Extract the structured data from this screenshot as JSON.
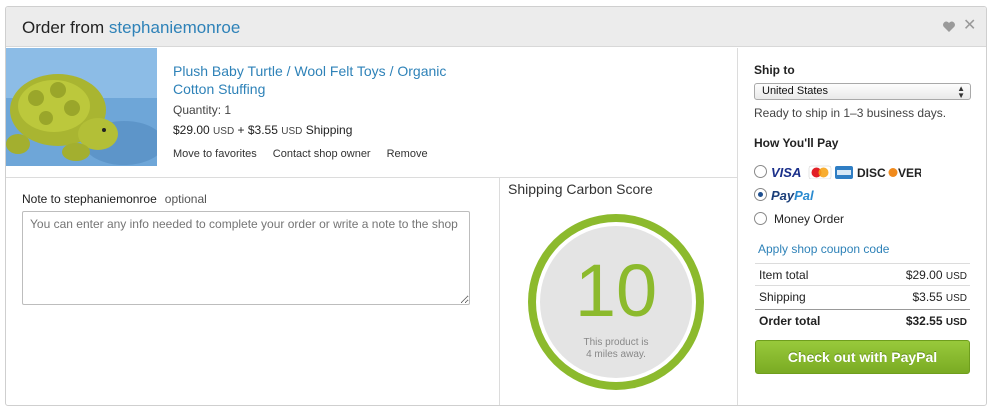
{
  "header": {
    "title_prefix": "Order from ",
    "shop_name": "stephaniemonroe"
  },
  "item": {
    "title": "Plush Baby Turtle / Wool Felt Toys / Organic Cotton Stuffing",
    "quantity": "Quantity: 1",
    "price": "$29.00",
    "price_currency": "USD",
    "plus": " + ",
    "shipping": "$3.55",
    "shipping_currency": "USD",
    "shipping_label": " Shipping",
    "links": [
      "Move to favorites",
      "Contact shop owner",
      "Remove"
    ]
  },
  "note": {
    "label": "Note to stephaniemonroe",
    "optional": "optional",
    "placeholder": "You can enter any info needed to complete your order or write a note to the shop"
  },
  "carbon": {
    "title": "Shipping Carbon Score",
    "score": "10",
    "line1": "This product is",
    "line2": "4 miles away.",
    "ring_color": "#8cba2d"
  },
  "ship": {
    "label": "Ship to",
    "country": "United States",
    "ready": "Ready to ship in 1–3 business days."
  },
  "payment": {
    "label": "How You'll Pay",
    "card_brands": [
      "VISA",
      "MasterCard",
      "American Express",
      "DISCOVER"
    ],
    "paypal_pay": "Pay",
    "paypal_pal": "Pal",
    "paypal_selected": true,
    "money_order": "Money Order",
    "coupon": "Apply shop coupon code"
  },
  "totals": {
    "item_label": "Item total",
    "item_value": "$29.00",
    "shipping_label": "Shipping",
    "shipping_value": "$3.55",
    "order_label": "Order total",
    "order_value": "$32.55",
    "currency": "USD"
  },
  "checkout": {
    "label": "Check out with PayPal",
    "color": "#8cba2d"
  },
  "colors": {
    "link": "#2e82b8",
    "accent_green": "#8cba2d"
  }
}
